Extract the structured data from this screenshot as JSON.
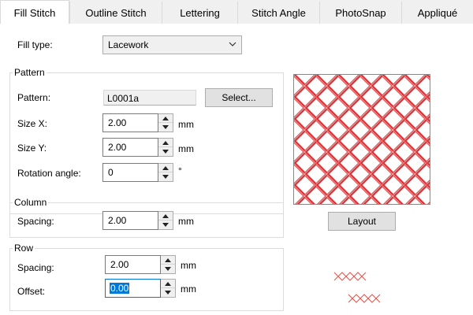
{
  "tabs": [
    {
      "label": "Fill Stitch",
      "active": true
    },
    {
      "label": "Outline Stitch",
      "active": false
    },
    {
      "label": "Lettering",
      "active": false
    },
    {
      "label": "Stitch Angle",
      "active": false
    },
    {
      "label": "PhotoSnap",
      "active": false
    },
    {
      "label": "Appliqué",
      "active": false
    }
  ],
  "fill_type": {
    "label": "Fill type:",
    "value": "Lacework"
  },
  "pattern_group": {
    "title": "Pattern",
    "pattern_label": "Pattern:",
    "pattern_value": "L0001a",
    "select_button": "Select...",
    "size_x": {
      "label": "Size X:",
      "value": "2.00",
      "unit": "mm"
    },
    "size_y": {
      "label": "Size Y:",
      "value": "2.00",
      "unit": "mm"
    },
    "rotation": {
      "label": "Rotation angle:",
      "value": "0",
      "unit": "°"
    }
  },
  "column_group": {
    "title": "Column",
    "spacing": {
      "label": "Spacing:",
      "value": "2.00",
      "unit": "mm"
    }
  },
  "row_group": {
    "title": "Row",
    "spacing": {
      "label": "Spacing:",
      "value": "2.00",
      "unit": "mm"
    },
    "offset": {
      "label": "Offset:",
      "value": "0.00",
      "unit": "mm"
    }
  },
  "layout_button": "Layout",
  "colors": {
    "thread_red": "#d7373a",
    "selection": "#0078d7"
  },
  "icons": {
    "dropdown": "chevron-down-icon",
    "spin_up": "spin-up-icon",
    "spin_down": "spin-down-icon"
  }
}
